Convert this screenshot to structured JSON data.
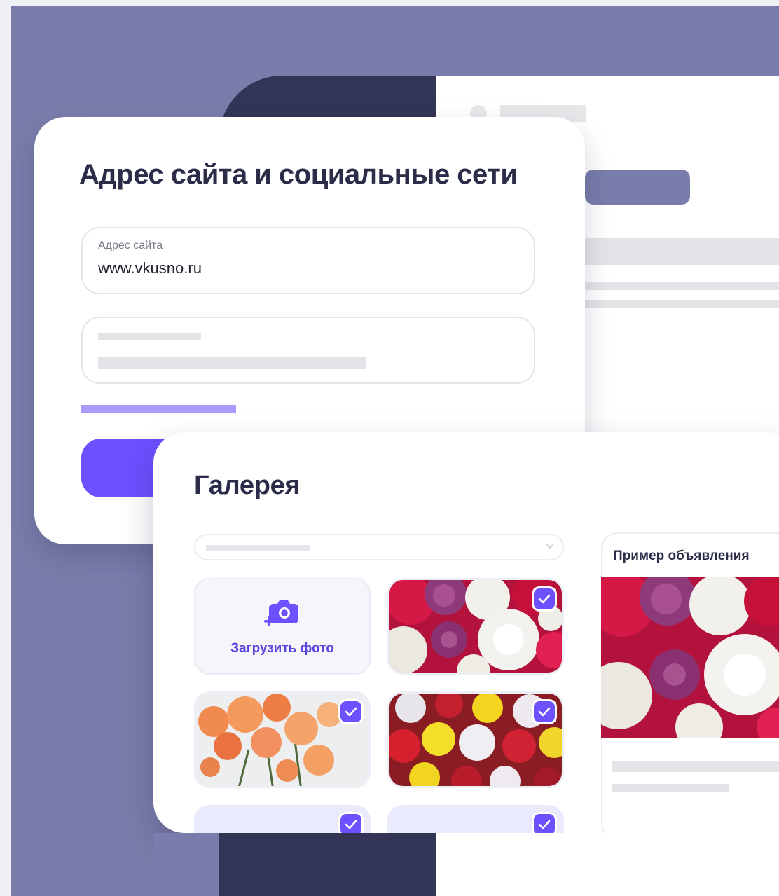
{
  "site_card": {
    "title": "Адрес сайта и социальные сети",
    "website_field": {
      "label": "Адрес сайта",
      "value": "www.vkusno.ru"
    }
  },
  "gallery_card": {
    "title": "Галерея",
    "upload_label": "Загрузить фото",
    "example_title": "Пример объявления"
  },
  "colors": {
    "accent": "#6e50ff",
    "background_panel": "#7a7cab",
    "dark_block": "#333556",
    "heading": "#2b2c48"
  },
  "icons": [
    "add-photo-icon",
    "checkmark-icon",
    "chevron-down-icon"
  ]
}
